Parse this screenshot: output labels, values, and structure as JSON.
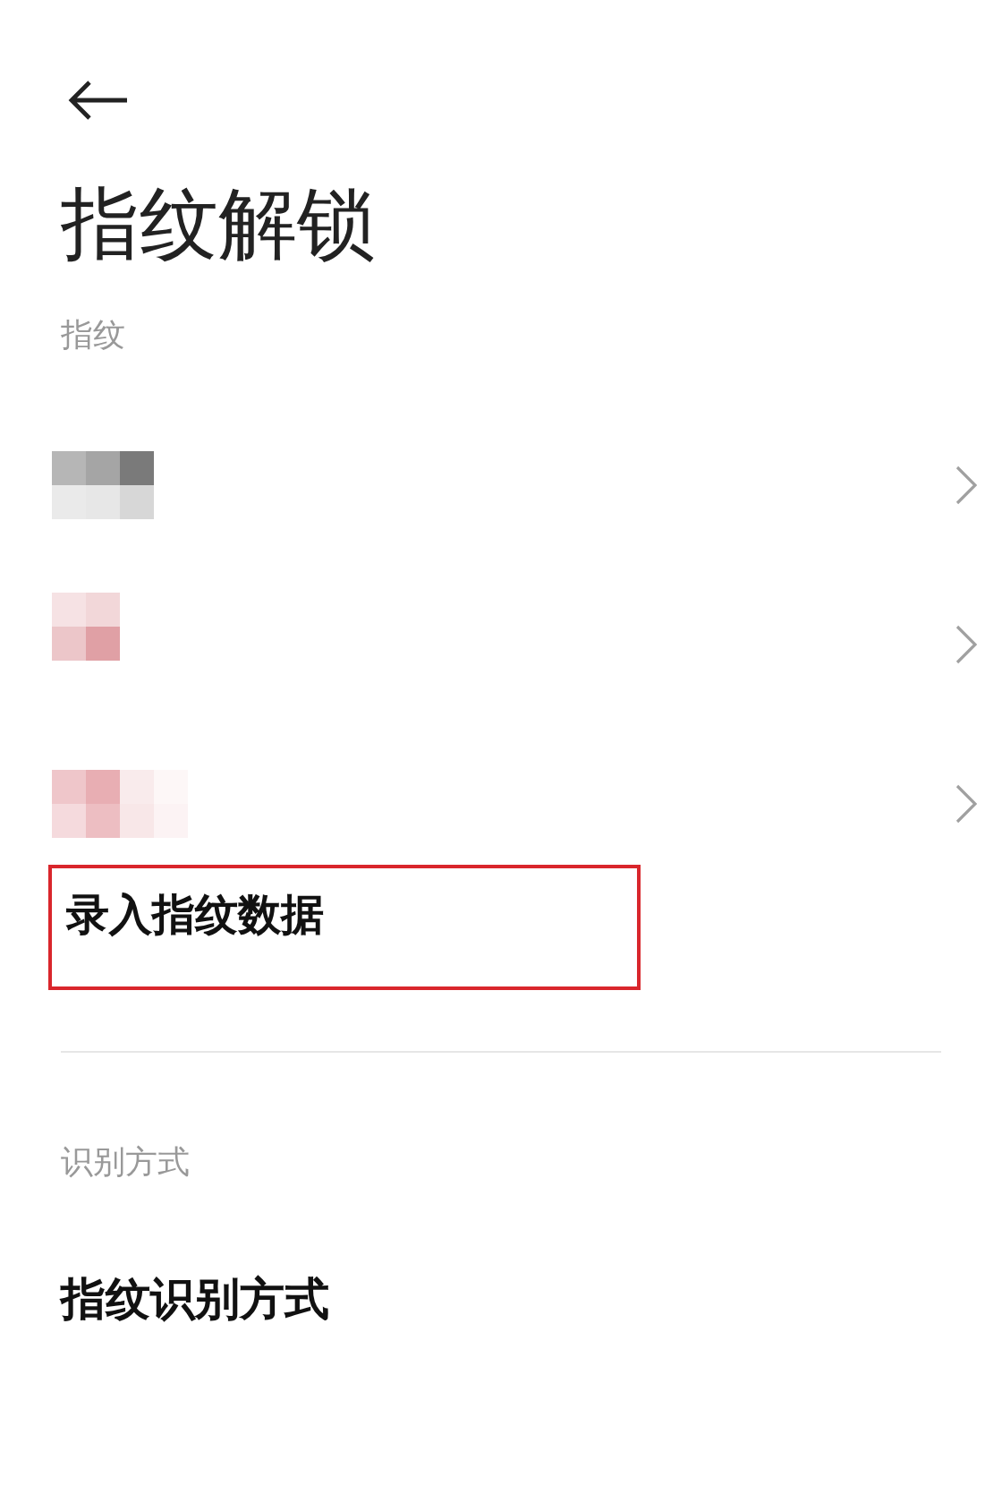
{
  "title": "指纹解锁",
  "fingerprint_section": {
    "header": "指纹",
    "fingerprints": [
      {
        "color": "#7a7a7a"
      },
      {
        "color": "#e0a0a5"
      },
      {
        "color": "#e8aeb3"
      }
    ],
    "enroll": {
      "label": "录入指纹数据",
      "highlighted": true
    }
  },
  "recognition_section": {
    "header": "识别方式",
    "items": [
      {
        "label": "指纹识别方式"
      }
    ]
  }
}
